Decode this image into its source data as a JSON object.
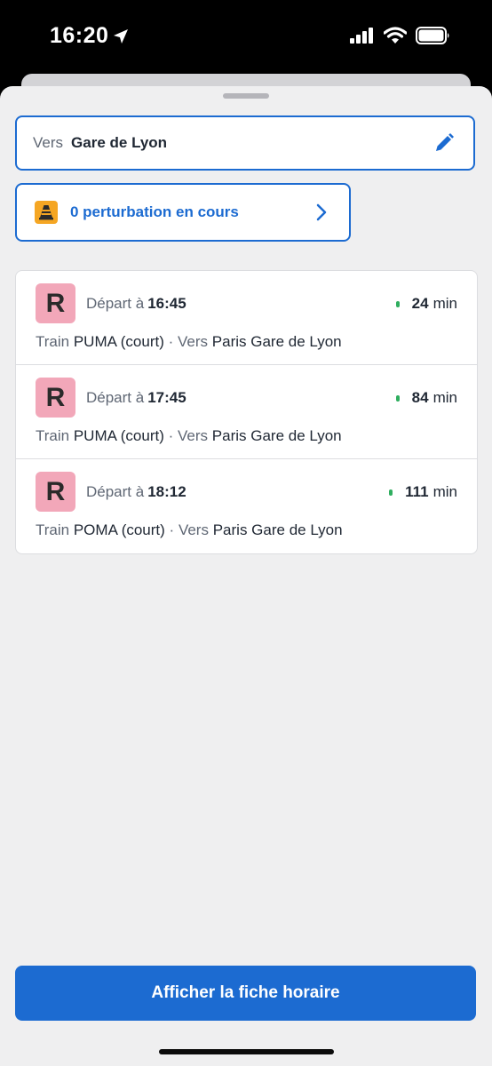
{
  "status_bar": {
    "time": "16:20",
    "icons": [
      "location-arrow-icon",
      "cellular-signal-icon",
      "wifi-icon",
      "battery-icon"
    ]
  },
  "destination": {
    "prefix": "Vers",
    "value": "Gare de Lyon",
    "edit_icon": "pencil-icon"
  },
  "disruptions": {
    "label": "0 perturbation en cours",
    "icon": "traffic-cone-icon"
  },
  "departures": [
    {
      "line": "R",
      "departure_prefix": "Départ à",
      "time": "16:45",
      "wait_value": "24",
      "wait_unit": "min",
      "train_label": "Train",
      "train_name": "PUMA (court)",
      "separator": "·",
      "direction_label": "Vers",
      "direction": "Paris Gare de Lyon"
    },
    {
      "line": "R",
      "departure_prefix": "Départ à",
      "time": "17:45",
      "wait_value": "84",
      "wait_unit": "min",
      "train_label": "Train",
      "train_name": "PUMA (court)",
      "separator": "·",
      "direction_label": "Vers",
      "direction": "Paris Gare de Lyon"
    },
    {
      "line": "R",
      "departure_prefix": "Départ à",
      "time": "18:12",
      "wait_value": "111",
      "wait_unit": "min",
      "train_label": "Train",
      "train_name": "POMA (court)",
      "separator": "·",
      "direction_label": "Vers",
      "direction": "Paris Gare de Lyon"
    }
  ],
  "cta": {
    "label": "Afficher la fiche horaire"
  },
  "colors": {
    "accent": "#1c6bd1",
    "line_badge": "#f2a7b9",
    "realtime": "#2fae5f",
    "warning": "#f5a623"
  }
}
